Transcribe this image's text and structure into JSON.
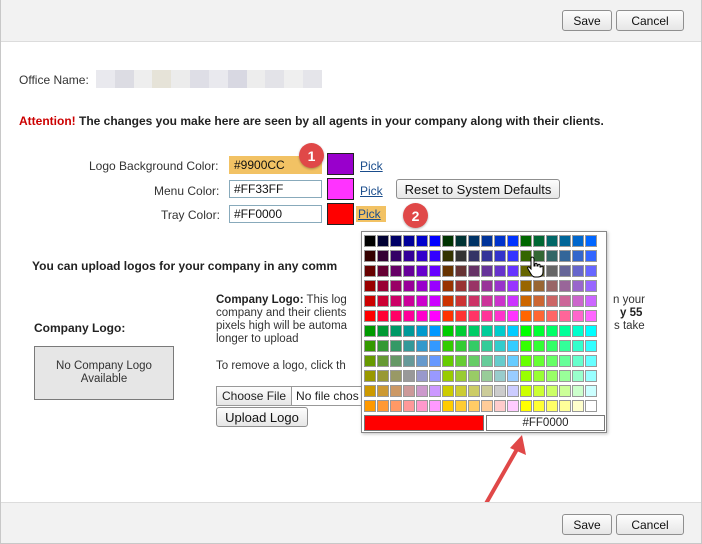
{
  "toolbar": {
    "save_label": "Save",
    "cancel_label": "Cancel"
  },
  "office": {
    "label": "Office Name:"
  },
  "attention": {
    "prefix": "Attention!",
    "text": " The changes you make here are seen by all agents in your company along with their clients."
  },
  "colors": {
    "logo_bg": {
      "label": "Logo Background Color:",
      "value": "#9900CC",
      "swatch": "#9900CC",
      "pick": "Pick"
    },
    "menu": {
      "label": "Menu Color:",
      "value": "#FF33FF",
      "swatch": "#FF33FF",
      "pick": "Pick"
    },
    "tray": {
      "label": "Tray Color:",
      "value": "#FF0000",
      "swatch": "#FF0000",
      "pick": "Pick"
    },
    "reset_label": "Reset to System Defaults"
  },
  "badges": {
    "one": "1",
    "two": "2"
  },
  "upload": {
    "intro": "You can upload logos for your company in any comm",
    "company_logo_label": "Company Logo:",
    "no_logo_line1": "No Company Logo",
    "no_logo_line2": "Available",
    "desc_title": "Company Logo:",
    "desc_line1": " This log",
    "desc_line1_tail": "n your",
    "desc_line2": "company and their clients",
    "desc_line2_tail": "y 55",
    "desc_line3": "pixels high will be automa",
    "desc_line3_tail": "s take",
    "desc_line4": "longer to upload",
    "remove_text": "To remove a logo, click th",
    "choose_file": "Choose File",
    "no_file": "No file chos",
    "upload_button": "Upload Logo"
  },
  "palette": {
    "hex_value": "#FF0000",
    "preview_color": "#FF0000"
  },
  "accent_colors": {
    "highlight": "#F2C264",
    "attention": "#CC0000",
    "badge": "#E04848",
    "arrow": "#E04848"
  }
}
